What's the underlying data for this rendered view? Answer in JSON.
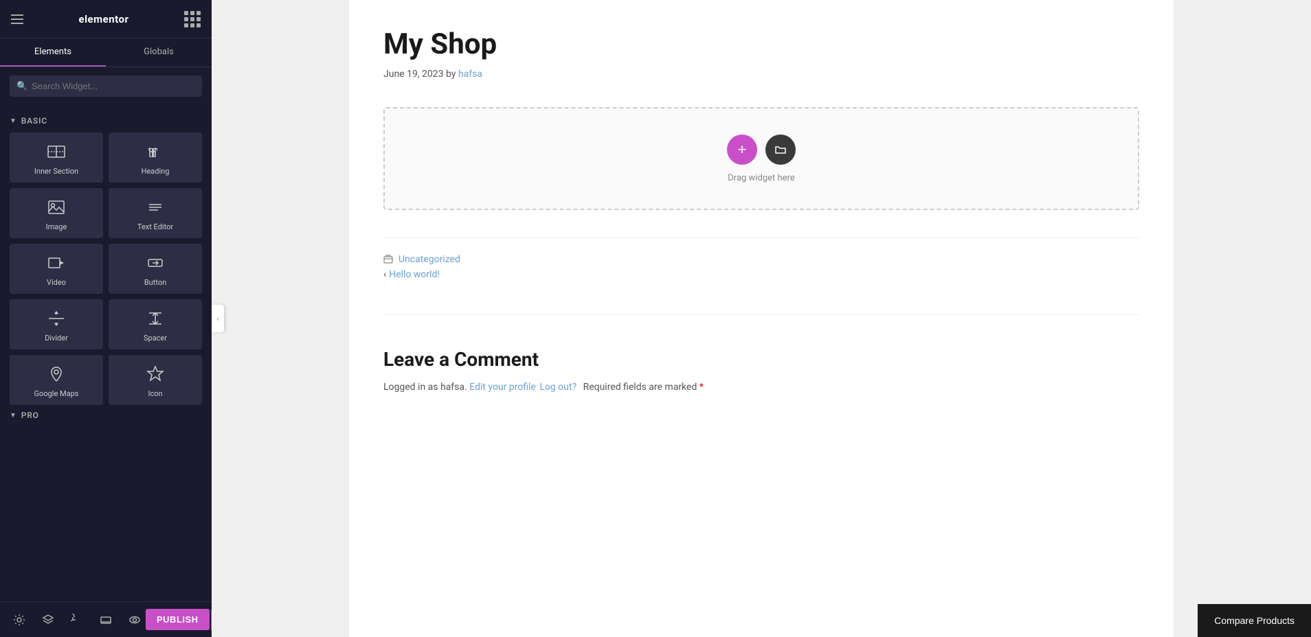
{
  "panel": {
    "logo": "elementor",
    "tabs": [
      {
        "label": "Elements",
        "active": true
      },
      {
        "label": "Globals",
        "active": false
      }
    ],
    "search": {
      "placeholder": "Search Widget..."
    },
    "sections": [
      {
        "name": "Basic",
        "widgets": [
          {
            "id": "inner-section",
            "label": "Inner Section",
            "icon": "inner-section-icon"
          },
          {
            "id": "heading",
            "label": "Heading",
            "icon": "heading-icon"
          },
          {
            "id": "image",
            "label": "Image",
            "icon": "image-icon"
          },
          {
            "id": "text-editor",
            "label": "Text Editor",
            "icon": "text-editor-icon"
          },
          {
            "id": "video",
            "label": "Video",
            "icon": "video-icon"
          },
          {
            "id": "button",
            "label": "Button",
            "icon": "button-icon"
          },
          {
            "id": "divider",
            "label": "Divider",
            "icon": "divider-icon"
          },
          {
            "id": "spacer",
            "label": "Spacer",
            "icon": "spacer-icon"
          },
          {
            "id": "google-maps",
            "label": "Google Maps",
            "icon": "google-maps-icon"
          },
          {
            "id": "icon",
            "label": "Icon",
            "icon": "icon-icon"
          }
        ]
      },
      {
        "name": "Pro",
        "widgets": []
      }
    ]
  },
  "toolbar": {
    "settings_icon": "⚙",
    "layers_icon": "◧",
    "history_icon": "↺",
    "responsive_icon": "▭",
    "preview_icon": "👁",
    "publish_label": "PUBLISH",
    "chevron": "▾"
  },
  "page": {
    "title": "My Shop",
    "meta": {
      "date": "June 19, 2023",
      "by": "by",
      "author": "hafsa",
      "author_href": "#"
    },
    "dropzone": {
      "drag_text": "Drag widget here"
    },
    "footer": {
      "category_label": "Uncategorized",
      "category_href": "#",
      "prev_arrow": "‹",
      "prev_label": "Hello world!",
      "prev_href": "#"
    },
    "comments": {
      "title": "Leave a Comment",
      "logged_in_text": "Logged in as hafsa.",
      "edit_profile_label": "Edit your profile",
      "edit_profile_href": "#",
      "logout_label": "Log out?",
      "logout_href": "#",
      "required_text": "Required fields are marked",
      "required_star": "*"
    }
  },
  "compare_products": {
    "label": "Compare Products"
  }
}
